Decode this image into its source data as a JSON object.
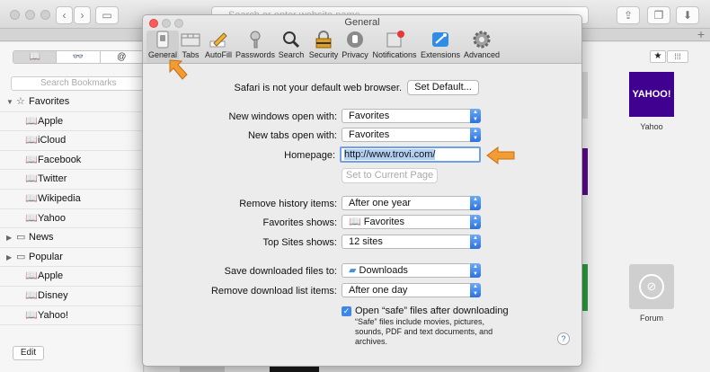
{
  "browser": {
    "address_placeholder": "Search or enter website name",
    "back_icon": "chevron-left-icon",
    "forward_icon": "chevron-right-icon"
  },
  "sidebar": {
    "tabs": [
      "📖",
      "👓",
      "@"
    ],
    "search_placeholder": "Search Bookmarks",
    "items": [
      {
        "label": "Favorites",
        "icon": "star-icon",
        "indent": 0,
        "disclosure": "down"
      },
      {
        "label": "Apple",
        "icon": "book-icon",
        "indent": 1
      },
      {
        "label": "iCloud",
        "icon": "book-icon",
        "indent": 1
      },
      {
        "label": "Facebook",
        "icon": "book-icon",
        "indent": 1
      },
      {
        "label": "Twitter",
        "icon": "book-icon",
        "indent": 1
      },
      {
        "label": "Wikipedia",
        "icon": "book-icon",
        "indent": 1
      },
      {
        "label": "Yahoo",
        "icon": "book-icon",
        "indent": 1
      },
      {
        "label": "News",
        "icon": "folder-icon",
        "indent": 0,
        "disclosure": "right"
      },
      {
        "label": "Popular",
        "icon": "folder-icon",
        "indent": 0,
        "disclosure": "right"
      },
      {
        "label": "Apple",
        "icon": "book-icon",
        "indent": 1
      },
      {
        "label": "Disney",
        "icon": "book-icon",
        "indent": 1
      },
      {
        "label": "Yahoo!",
        "icon": "book-icon",
        "indent": 1
      }
    ],
    "edit_label": "Edit"
  },
  "favorites_view": {
    "tiles": [
      {
        "label": "Yahoo",
        "tile_text": "YAHOO!",
        "color": "#400090"
      },
      {
        "label": "Forum",
        "color": "#cfcfcf"
      }
    ]
  },
  "prefs": {
    "title": "General",
    "toolbar": [
      {
        "label": "General",
        "icon": "switch-icon",
        "selected": true
      },
      {
        "label": "Tabs",
        "icon": "tabs-icon"
      },
      {
        "label": "AutoFill",
        "icon": "pencil-icon"
      },
      {
        "label": "Passwords",
        "icon": "key-icon"
      },
      {
        "label": "Search",
        "icon": "magnifier-icon"
      },
      {
        "label": "Security",
        "icon": "lock-icon"
      },
      {
        "label": "Privacy",
        "icon": "hand-icon"
      },
      {
        "label": "Notifications",
        "icon": "notification-icon"
      },
      {
        "label": "Extensions",
        "icon": "puzzle-icon"
      },
      {
        "label": "Advanced",
        "icon": "gear-icon"
      }
    ],
    "default_browser_text": "Safari is not your default web browser.",
    "set_default_label": "Set Default...",
    "new_windows_label": "New windows open with:",
    "new_windows_value": "Favorites",
    "new_tabs_label": "New tabs open with:",
    "new_tabs_value": "Favorites",
    "homepage_label": "Homepage:",
    "homepage_value": "http://www.trovi.com/",
    "set_current_label": "Set to Current Page",
    "remove_history_label": "Remove history items:",
    "remove_history_value": "After one year",
    "favorites_shows_label": "Favorites shows:",
    "favorites_shows_value": "Favorites",
    "top_sites_label": "Top Sites shows:",
    "top_sites_value": "12 sites",
    "save_downloads_label": "Save downloaded files to:",
    "save_downloads_value": "Downloads",
    "remove_download_label": "Remove download list items:",
    "remove_download_value": "After one day",
    "open_safe_label": "Open “safe” files after downloading",
    "safe_note_1": "“Safe” files include movies, pictures,",
    "safe_note_2": "sounds, PDF and text documents, and",
    "safe_note_3": "archives.",
    "help_label": "?"
  },
  "accent": "#f39c34"
}
